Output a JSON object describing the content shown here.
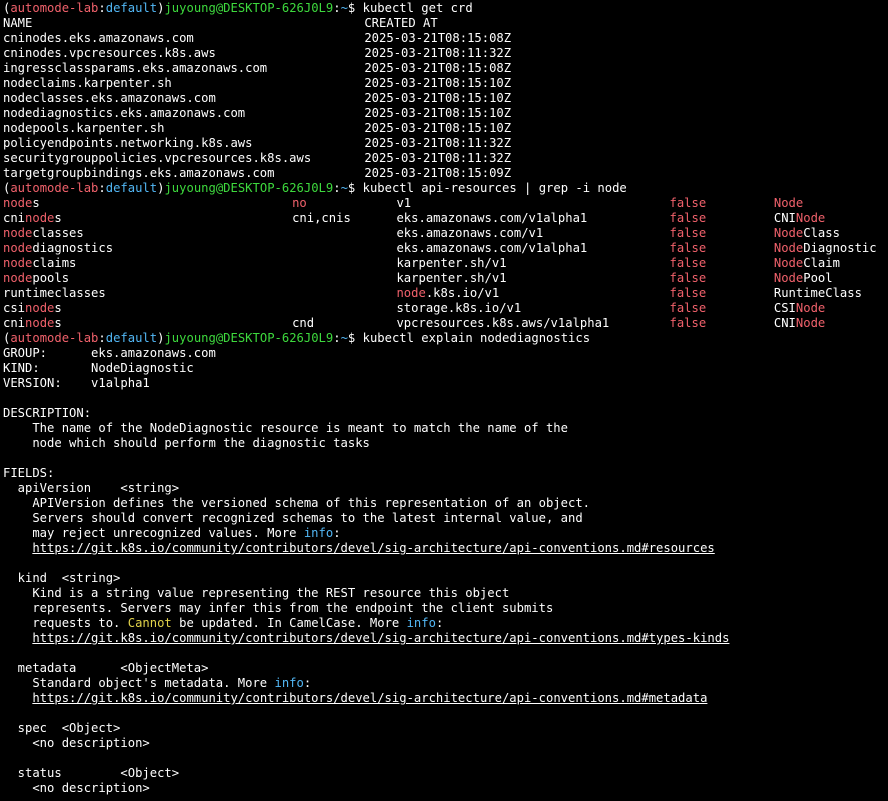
{
  "colors": {
    "background": "#000000",
    "text": "#ffffff",
    "red": "#f0616b",
    "cyan": "#52b7f5",
    "green": "#3dd93d",
    "yellow": "#e2d34a"
  },
  "prompt": {
    "paren_open": "(",
    "context": "automode-lab",
    "colon": ":",
    "namespace": "default",
    "paren_close": ")",
    "user_host": "juyoung@DESKTOP-626J0L9",
    "sep": ":",
    "path": "~",
    "dollar": "$"
  },
  "commands": [
    "kubectl get crd",
    "kubectl api-resources | grep -i node",
    "kubectl explain nodediagnostics"
  ],
  "crd": {
    "headers": [
      "NAME",
      "CREATED AT"
    ],
    "rows": [
      [
        "cninodes.eks.amazonaws.com",
        "2025-03-21T08:15:08Z"
      ],
      [
        "cninodes.vpcresources.k8s.aws",
        "2025-03-21T08:11:32Z"
      ],
      [
        "ingressclassparams.eks.amazonaws.com",
        "2025-03-21T08:15:08Z"
      ],
      [
        "nodeclaims.karpenter.sh",
        "2025-03-21T08:15:10Z"
      ],
      [
        "nodeclasses.eks.amazonaws.com",
        "2025-03-21T08:15:10Z"
      ],
      [
        "nodediagnostics.eks.amazonaws.com",
        "2025-03-21T08:15:10Z"
      ],
      [
        "nodepools.karpenter.sh",
        "2025-03-21T08:15:10Z"
      ],
      [
        "policyendpoints.networking.k8s.aws",
        "2025-03-21T08:11:32Z"
      ],
      [
        "securitygrouppolicies.vpcresources.k8s.aws",
        "2025-03-21T08:11:32Z"
      ],
      [
        "targetgroupbindings.eks.amazonaws.com",
        "2025-03-21T08:15:09Z"
      ]
    ]
  },
  "api": {
    "rows": [
      {
        "name": [
          [
            "node",
            "r"
          ],
          [
            "s",
            ""
          ]
        ],
        "short": [
          [
            "no",
            "r"
          ]
        ],
        "version": [
          [
            "v1",
            ""
          ]
        ],
        "namespaced": "false",
        "kind": [
          [
            "Node",
            "r"
          ]
        ]
      },
      {
        "name": [
          [
            "cni",
            ""
          ],
          [
            "node",
            "r"
          ],
          [
            "s",
            ""
          ]
        ],
        "short": [
          [
            "cni,cnis",
            ""
          ]
        ],
        "version": [
          [
            "eks.amazonaws.com/v1alpha1",
            ""
          ]
        ],
        "namespaced": "false",
        "kind": [
          [
            "CNI",
            ""
          ],
          [
            "Node",
            "r"
          ]
        ]
      },
      {
        "name": [
          [
            "node",
            "r"
          ],
          [
            "classes",
            ""
          ]
        ],
        "short": [],
        "version": [
          [
            "eks.amazonaws.com/v1",
            ""
          ]
        ],
        "namespaced": "false",
        "kind": [
          [
            "Node",
            "r"
          ],
          [
            "Class",
            ""
          ]
        ]
      },
      {
        "name": [
          [
            "node",
            "r"
          ],
          [
            "diagnostics",
            ""
          ]
        ],
        "short": [],
        "version": [
          [
            "eks.amazonaws.com/v1alpha1",
            ""
          ]
        ],
        "namespaced": "false",
        "kind": [
          [
            "Node",
            "r"
          ],
          [
            "Diagnostic",
            ""
          ]
        ]
      },
      {
        "name": [
          [
            "node",
            "r"
          ],
          [
            "claims",
            ""
          ]
        ],
        "short": [],
        "version": [
          [
            "karpenter.sh/v1",
            ""
          ]
        ],
        "namespaced": "false",
        "kind": [
          [
            "Node",
            "r"
          ],
          [
            "Claim",
            ""
          ]
        ]
      },
      {
        "name": [
          [
            "node",
            "r"
          ],
          [
            "pools",
            ""
          ]
        ],
        "short": [],
        "version": [
          [
            "karpenter.sh/v1",
            ""
          ]
        ],
        "namespaced": "false",
        "kind": [
          [
            "Node",
            "r"
          ],
          [
            "Pool",
            ""
          ]
        ]
      },
      {
        "name": [
          [
            "runtimeclasses",
            ""
          ]
        ],
        "short": [],
        "version": [
          [
            "node",
            "r"
          ],
          [
            ".k8s.io/v1",
            ""
          ]
        ],
        "namespaced": "false",
        "kind": [
          [
            "RuntimeClass",
            ""
          ]
        ]
      },
      {
        "name": [
          [
            "csi",
            ""
          ],
          [
            "node",
            "r"
          ],
          [
            "s",
            ""
          ]
        ],
        "short": [],
        "version": [
          [
            "storage.k8s.io/v1",
            ""
          ]
        ],
        "namespaced": "false",
        "kind": [
          [
            "CSI",
            ""
          ],
          [
            "Node",
            "r"
          ]
        ]
      },
      {
        "name": [
          [
            "cni",
            ""
          ],
          [
            "node",
            "r"
          ],
          [
            "s",
            ""
          ]
        ],
        "short": [
          [
            "cnd",
            ""
          ]
        ],
        "version": [
          [
            "vpcresources.k8s.aws/v1alpha1",
            ""
          ]
        ],
        "namespaced": "false",
        "kind": [
          [
            "CNI",
            ""
          ],
          [
            "Node",
            "r"
          ]
        ]
      }
    ]
  },
  "explain": [
    [
      [
        "GROUP:      eks.amazonaws.com",
        ""
      ]
    ],
    [
      [
        "KIND:       NodeDiagnostic",
        ""
      ]
    ],
    [
      [
        "VERSION:    v1alpha1",
        ""
      ]
    ],
    [
      [
        "",
        ""
      ]
    ],
    [
      [
        "DESCRIPTION:",
        ""
      ]
    ],
    [
      [
        "    The name of the NodeDiagnostic resource is meant to match the name of the",
        ""
      ]
    ],
    [
      [
        "    node which should perform the diagnostic tasks",
        ""
      ]
    ],
    [
      [
        "",
        ""
      ]
    ],
    [
      [
        "FIELDS:",
        ""
      ]
    ],
    [
      [
        "  apiVersion    <string>",
        ""
      ]
    ],
    [
      [
        "    APIVersion defines the versioned schema of this representation of an object.",
        ""
      ]
    ],
    [
      [
        "    Servers should convert recognized schemas to the latest internal value, and",
        ""
      ]
    ],
    [
      [
        "    may reject unrecognized values. More ",
        ""
      ],
      [
        "info",
        "c"
      ],
      [
        ":",
        ""
      ]
    ],
    [
      [
        "    ",
        ""
      ],
      [
        "https://git.k8s.io/community/contributors/devel/sig-architecture/api-conventions.md#resources",
        "u"
      ]
    ],
    [
      [
        "",
        ""
      ]
    ],
    [
      [
        "  kind  <string>",
        ""
      ]
    ],
    [
      [
        "    Kind is a string value representing the REST resource this object",
        ""
      ]
    ],
    [
      [
        "    represents. Servers may infer this from the endpoint the client submits",
        ""
      ]
    ],
    [
      [
        "    requests to. ",
        ""
      ],
      [
        "Cannot",
        "y"
      ],
      [
        " be updated. In CamelCase. More ",
        ""
      ],
      [
        "info",
        "c"
      ],
      [
        ":",
        ""
      ]
    ],
    [
      [
        "    ",
        ""
      ],
      [
        "https://git.k8s.io/community/contributors/devel/sig-architecture/api-conventions.md#types-kinds",
        "u"
      ]
    ],
    [
      [
        "",
        ""
      ]
    ],
    [
      [
        "  metadata      <ObjectMeta>",
        ""
      ]
    ],
    [
      [
        "    Standard object's metadata. More ",
        ""
      ],
      [
        "info",
        "c"
      ],
      [
        ":",
        ""
      ]
    ],
    [
      [
        "    ",
        ""
      ],
      [
        "https://git.k8s.io/community/contributors/devel/sig-architecture/api-conventions.md#metadata",
        "u"
      ]
    ],
    [
      [
        "",
        ""
      ]
    ],
    [
      [
        "  spec  <Object>",
        ""
      ]
    ],
    [
      [
        "    <no description>",
        ""
      ]
    ],
    [
      [
        "",
        ""
      ]
    ],
    [
      [
        "  status        <Object>",
        ""
      ]
    ],
    [
      [
        "    <no description>",
        ""
      ]
    ]
  ]
}
